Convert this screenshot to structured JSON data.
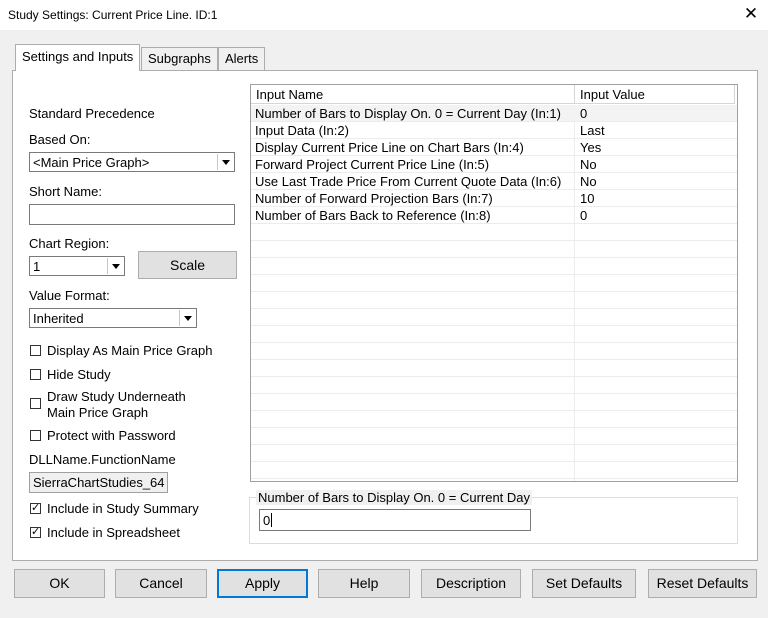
{
  "window": {
    "title": "Study Settings: Current Price Line. ID:1",
    "close_glyph": "✕"
  },
  "tabs": [
    {
      "label": "Settings and Inputs",
      "active": true
    },
    {
      "label": "Subgraphs",
      "active": false
    },
    {
      "label": "Alerts",
      "active": false
    }
  ],
  "left": {
    "standard_precedence": "Standard Precedence",
    "based_on_label": "Based On:",
    "based_on_value": "<Main Price Graph>",
    "short_name_label": "Short Name:",
    "short_name_value": "",
    "chart_region_label": "Chart Region:",
    "chart_region_value": "1",
    "scale_button": "Scale",
    "value_format_label": "Value Format:",
    "value_format_value": "Inherited",
    "checkboxes": [
      {
        "label": "Display As Main Price Graph",
        "checked": false
      },
      {
        "label": "Hide Study",
        "checked": false
      },
      {
        "label": "Draw Study Underneath",
        "label2": "Main Price Graph",
        "checked": false
      },
      {
        "label": "Protect with Password",
        "checked": false
      }
    ],
    "dll_label": "DLLName.FunctionName",
    "dll_value": "SierraChartStudies_64",
    "summary_checkbox": {
      "label": "Include in Study Summary",
      "checked": true
    },
    "spreadsheet_checkbox": {
      "label": "Include in Spreadsheet",
      "checked": true
    },
    "check_glyph": "✓"
  },
  "grid": {
    "headers": [
      "Input Name",
      "Input Value"
    ],
    "rows": [
      {
        "name": "Number of Bars to Display On. 0 = Current Day   (In:1)",
        "value": "0"
      },
      {
        "name": "Input Data   (In:2)",
        "value": "Last"
      },
      {
        "name": "Display Current Price Line on Chart Bars   (In:4)",
        "value": "Yes"
      },
      {
        "name": "Forward Project Current Price Line   (In:5)",
        "value": "No"
      },
      {
        "name": "Use Last Trade Price From Current Quote Data   (In:6)",
        "value": "No"
      },
      {
        "name": "Number of Forward Projection Bars   (In:7)",
        "value": "10"
      },
      {
        "name": "Number of Bars Back to Reference   (In:8)",
        "value": "0"
      }
    ]
  },
  "edit": {
    "label": "Number of Bars to Display On. 0 = Current Day",
    "value": "0"
  },
  "buttons": {
    "ok": "OK",
    "cancel": "Cancel",
    "apply": "Apply",
    "help": "Help",
    "description": "Description",
    "set_defaults": "Set Defaults",
    "reset_defaults": "Reset Defaults"
  }
}
